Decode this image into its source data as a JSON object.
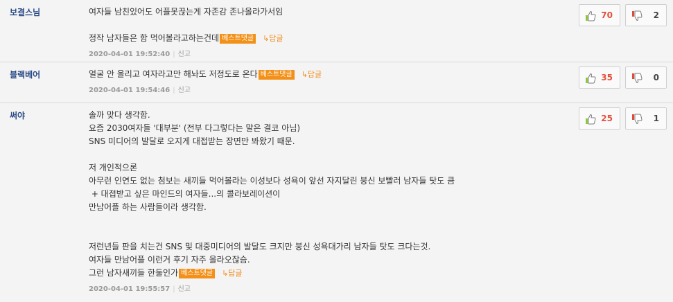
{
  "comments": [
    {
      "nickname": "보결스님",
      "lines": [
        "여자들 남친있어도 어플못끊는게 자존감 존나올라가서임",
        "",
        "정작 남자들은 함 먹어볼라고하는건데"
      ],
      "best_label": "베스트댓글",
      "reply_label": "↳답글",
      "date": "2020-04-01 19:52:40",
      "report_label": "신고",
      "likes": "70",
      "dislikes": "2"
    },
    {
      "nickname": "블랙베어",
      "lines": [
        "얼굴 안 올리고 여자라고만 해놔도 저정도로 온다"
      ],
      "best_label": "베스트댓글",
      "reply_label": "↳답글",
      "date": "2020-04-01 19:54:46",
      "report_label": "신고",
      "likes": "35",
      "dislikes": "0"
    },
    {
      "nickname": "써야",
      "lines": [
        "솔까 맞다 생각함.",
        "요즘 2030여자들 '대부분' (전부 다그렇다는 말은 결코 아님)",
        "SNS 미디어의 발달로 오지게 대접받는 장면만 봐왔기 때문.",
        "",
        "저 개인적으론",
        "아무런 인연도 없는 첨보는 새끼들 먹어볼라는 이성보다 성욕이 앞선 자지달린 붕신 보빨러 남자들 탓도 큼",
        " + 대접받고 싶은 마인드의 여자들...의 콜라보레이션이",
        "만남어플 하는 사람들이라 생각함.",
        "",
        "",
        "저런년들 판을 치는건 SNS 및 대중미디어의 발달도 크지만 붕신 성욕대가리 남자들 탓도 크다는것.",
        "여자들 만남어플 이런거 후기 자주 올라오잖슴.",
        "그런 남자새끼들 한둘인가"
      ],
      "best_label": "베스트댓글",
      "reply_label": "↳답글",
      "date": "2020-04-01 19:55:57",
      "report_label": "신고",
      "likes": "25",
      "dislikes": "1"
    }
  ],
  "icons": {
    "thumb_up": "thumbs-up-icon",
    "thumb_down": "thumbs-down-icon"
  },
  "colors": {
    "best_badge": "#f39018",
    "reply_link": "#f08a1c",
    "nickname": "#2a4a86",
    "like_count": "#e2503a",
    "thumb_up_green": "#8cc63f",
    "thumb_down_red": "#e04a3a"
  }
}
